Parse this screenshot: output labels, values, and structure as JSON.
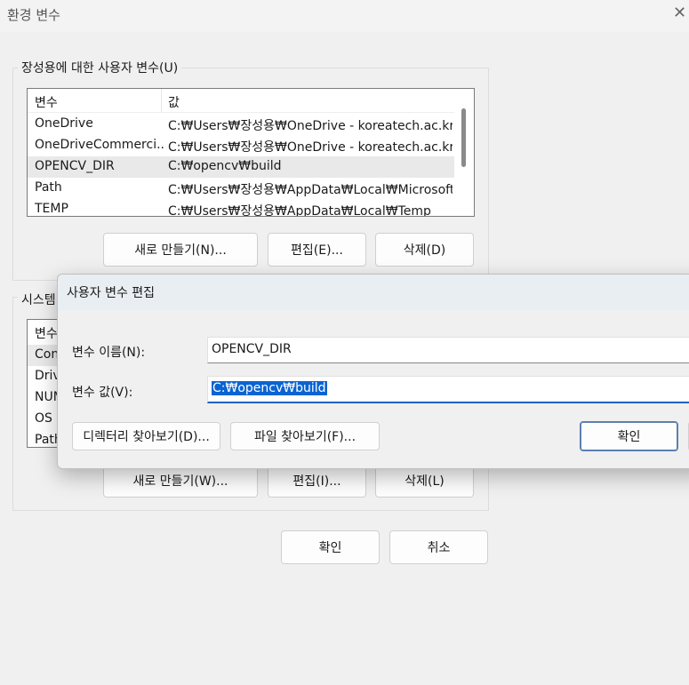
{
  "window": {
    "title": "환경 변수",
    "close_glyph": "✕"
  },
  "user_vars": {
    "legend": "장성용에 대한 사용자 변수(U)",
    "headers": [
      "변수",
      "값"
    ],
    "rows": [
      {
        "name": "OneDrive",
        "value": "C:₩Users₩장성용₩OneDrive - koreatech.ac.kr"
      },
      {
        "name": "OneDriveCommerci...",
        "value": "C:₩Users₩장성용₩OneDrive - koreatech.ac.kr"
      },
      {
        "name": "OPENCV_DIR",
        "value": "C:₩opencv₩build"
      },
      {
        "name": "Path",
        "value": "C:₩Users₩장성용₩AppData₩Local₩Microsoft..."
      },
      {
        "name": "TEMP",
        "value": "C:₩Users₩장성용₩AppData₩Local₩Temp"
      }
    ],
    "buttons": {
      "new": "새로 만들기(N)...",
      "edit": "편집(E)...",
      "delete": "삭제(D)"
    }
  },
  "system_vars": {
    "legend": "시스템",
    "header_partial": "변수",
    "rows_partial": [
      "Con",
      "Driv",
      "NUM",
      "OS",
      "Path"
    ],
    "buttons": {
      "new": "새로 만들기(W)...",
      "edit": "편집(I)...",
      "delete": "삭제(L)"
    }
  },
  "footer": {
    "ok": "확인",
    "cancel": "취소"
  },
  "edit_dialog": {
    "title": "사용자 변수 편집",
    "name_label": "변수 이름(N):",
    "name_value": "OPENCV_DIR",
    "value_label": "변수 값(V):",
    "value_value": "C:₩opencv₩build",
    "browse_dir": "디렉터리 찾아보기(D)...",
    "browse_file": "파일 찾아보기(F)...",
    "ok": "확인"
  }
}
